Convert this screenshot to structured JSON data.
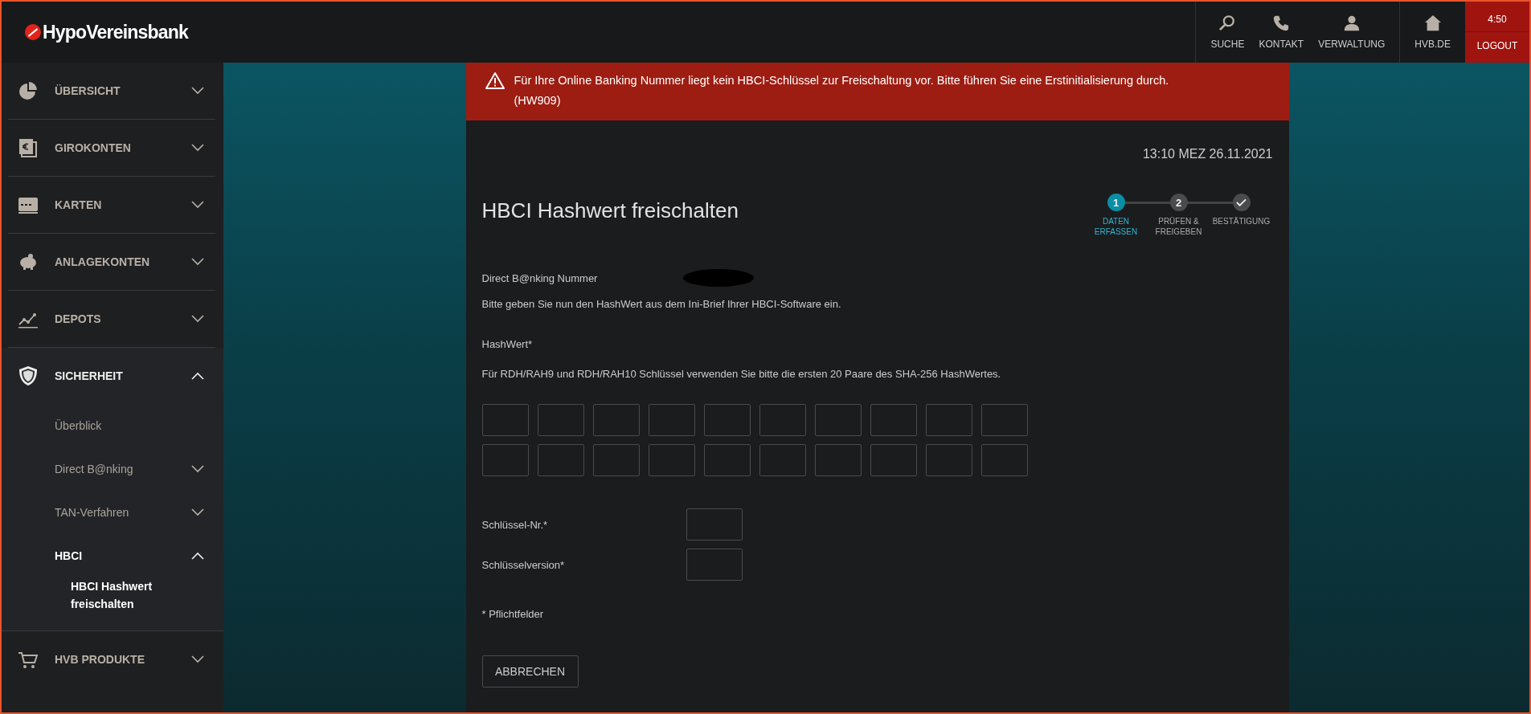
{
  "header": {
    "brand": "HypoVereinsbank",
    "actions": [
      {
        "label": "SUCHE"
      },
      {
        "label": "KONTAKT"
      },
      {
        "label": "VERWALTUNG"
      }
    ],
    "home": {
      "label": "HVB.DE"
    },
    "session": {
      "timer": "4:50",
      "logout": "LOGOUT"
    }
  },
  "sidebar": {
    "items": [
      {
        "label": "ÜBERSICHT",
        "expanded": false,
        "selected": false
      },
      {
        "label": "GIROKONTEN",
        "expanded": false,
        "selected": false
      },
      {
        "label": "KARTEN",
        "expanded": false,
        "selected": false
      },
      {
        "label": "ANLAGEKONTEN",
        "expanded": false,
        "selected": false
      },
      {
        "label": "DEPOTS",
        "expanded": false,
        "selected": false
      },
      {
        "label": "SICHERHEIT",
        "expanded": true,
        "selected": true,
        "children": [
          {
            "kind": "link",
            "label": "Überblick",
            "selected": false
          },
          {
            "kind": "group",
            "label": "Direct B@nking",
            "expanded": false,
            "selected": false
          },
          {
            "kind": "group",
            "label": "TAN-Verfahren",
            "expanded": false,
            "selected": false
          },
          {
            "kind": "group",
            "label": "HBCI",
            "expanded": true,
            "selected": true,
            "children": [
              {
                "label": "HBCI Hashwert freischalten",
                "selected": true
              }
            ]
          }
        ]
      },
      {
        "label": "HVB PRODUKTE",
        "expanded": false,
        "selected": false
      }
    ]
  },
  "alert": {
    "message": "Für Ihre Online Banking Nummer liegt kein HBCI-Schlüssel zur Freischaltung vor. Bitte führen Sie eine Erstinitialisierung durch.",
    "code": "(HW909)"
  },
  "timestamp": "13:10 MEZ 26.11.2021",
  "title": "HBCI Hashwert freischalten",
  "steps": [
    {
      "kind": "number",
      "marker": "1",
      "label": "DATEN ERFASSEN",
      "selected": true
    },
    {
      "kind": "number",
      "marker": "2",
      "label": "PRÜFEN & FREIGEBEN",
      "selected": false
    },
    {
      "kind": "check",
      "label": "BESTÄTIGUNG",
      "selected": false
    }
  ],
  "form": {
    "number_label": "Direct B@nking Nummer",
    "intro": "Bitte geben Sie nun den HashWert aus dem Ini-Brief Ihrer HBCI-Software ein.",
    "hash_label": "HashWert*",
    "hash_hint": "Für RDH/RAH9 und RDH/RAH10 Schlüssel verwenden Sie bitte die ersten 20 Paare des SHA-256 HashWertes.",
    "hash_fields": [
      {
        "kind": "pair"
      },
      {
        "kind": "pair"
      },
      {
        "kind": "pair"
      },
      {
        "kind": "pair"
      },
      {
        "kind": "pair"
      },
      {
        "kind": "pair"
      },
      {
        "kind": "pair"
      },
      {
        "kind": "pair"
      },
      {
        "kind": "pair"
      },
      {
        "kind": "pair"
      },
      {
        "kind": "pair"
      },
      {
        "kind": "pair"
      },
      {
        "kind": "pair"
      },
      {
        "kind": "pair"
      },
      {
        "kind": "pair"
      },
      {
        "kind": "pair"
      },
      {
        "kind": "pair"
      },
      {
        "kind": "pair"
      },
      {
        "kind": "pair"
      },
      {
        "kind": "pair"
      }
    ],
    "key_fields": [
      {
        "label": "Schlüssel-Nr.*"
      },
      {
        "label": "Schlüsselversion*"
      }
    ],
    "required_note": "* Pflichtfelder",
    "cancel": "ABBRECHEN"
  }
}
